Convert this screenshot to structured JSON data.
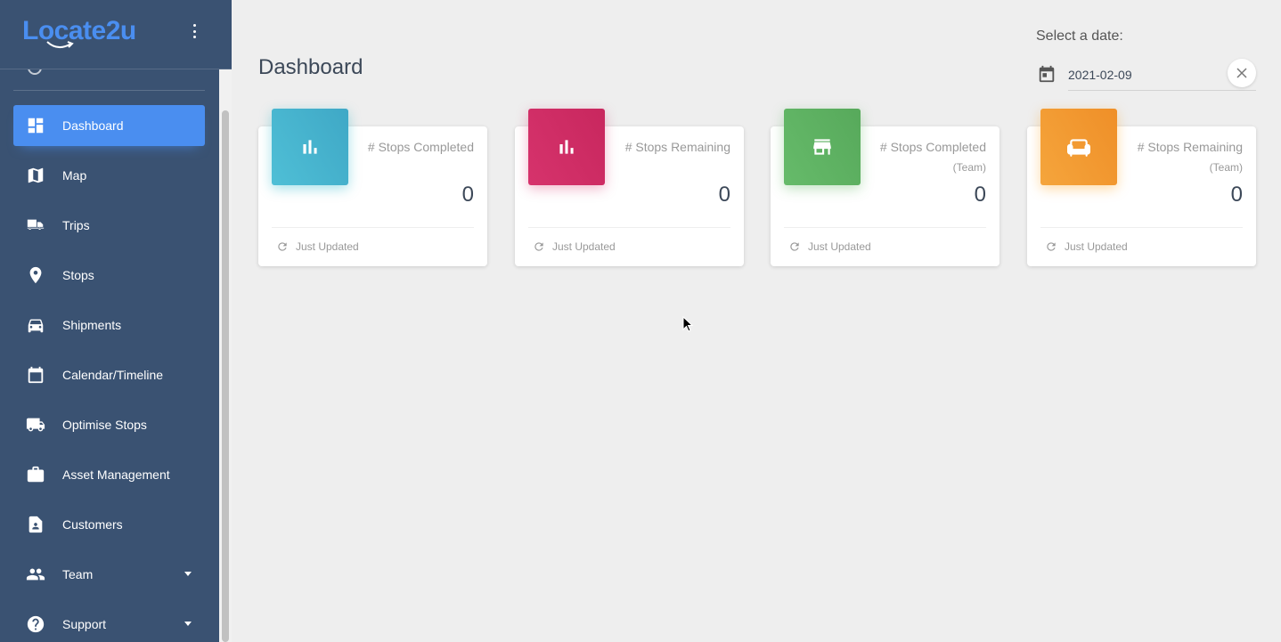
{
  "brand": {
    "name": "Locate2u"
  },
  "sidebar": {
    "items": [
      {
        "label": "Dashboard",
        "icon": "dashboard-icon",
        "active": true
      },
      {
        "label": "Map",
        "icon": "map-icon"
      },
      {
        "label": "Trips",
        "icon": "trips-icon"
      },
      {
        "label": "Stops",
        "icon": "location-pin-icon"
      },
      {
        "label": "Shipments",
        "icon": "car-icon"
      },
      {
        "label": "Calendar/Timeline",
        "icon": "calendar-icon"
      },
      {
        "label": "Optimise Stops",
        "icon": "truck-icon"
      },
      {
        "label": "Asset Management",
        "icon": "briefcase-icon"
      },
      {
        "label": "Customers",
        "icon": "contact-card-icon"
      },
      {
        "label": "Team",
        "icon": "people-icon",
        "expandable": true
      },
      {
        "label": "Support",
        "icon": "help-icon",
        "expandable": true
      }
    ]
  },
  "main": {
    "title": "Dashboard",
    "date_picker": {
      "label": "Select a date:",
      "value": "2021-02-09"
    }
  },
  "cards": [
    {
      "title": "# Stops Completed",
      "subtitle": "",
      "value": "0",
      "footer": "Just Updated",
      "color": "#4fbfd6",
      "icon": "bar-chart-icon"
    },
    {
      "title": "# Stops Remaining",
      "subtitle": "",
      "value": "0",
      "footer": "Just Updated",
      "color": "#d6336c",
      "icon": "bar-chart-icon"
    },
    {
      "title": "# Stops Completed",
      "subtitle": "(Team)",
      "value": "0",
      "footer": "Just Updated",
      "color": "#62b264",
      "icon": "store-icon"
    },
    {
      "title": "# Stops Remaining",
      "subtitle": "(Team)",
      "value": "0",
      "footer": "Just Updated",
      "color": "#f39c34",
      "icon": "couch-icon"
    }
  ],
  "colors": {
    "sidebar_bg": "#3a5272",
    "active_item": "#4a8ef0",
    "page_bg": "#eeeeee"
  }
}
